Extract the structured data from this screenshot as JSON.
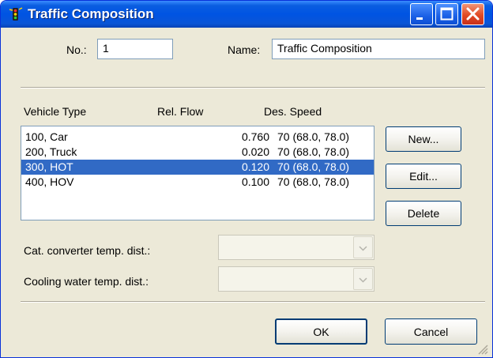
{
  "window": {
    "title": "Traffic Composition"
  },
  "form": {
    "no_label": "No.:",
    "no_value": "1",
    "name_label": "Name:",
    "name_value": "Traffic Composition"
  },
  "list": {
    "headers": [
      "Vehicle Type",
      "Rel. Flow",
      "Des. Speed"
    ],
    "rows": [
      {
        "type": "100, Car",
        "flow": "0.760",
        "speed": "70 (68.0, 78.0)",
        "selected": false
      },
      {
        "type": "200, Truck",
        "flow": "0.020",
        "speed": "70 (68.0, 78.0)",
        "selected": false
      },
      {
        "type": "300, HOT",
        "flow": "0.120",
        "speed": "70 (68.0, 78.0)",
        "selected": true
      },
      {
        "type": "400, HOV",
        "flow": "0.100",
        "speed": "70 (68.0, 78.0)",
        "selected": false
      }
    ]
  },
  "buttons": {
    "new": "New...",
    "edit": "Edit...",
    "delete": "Delete",
    "ok": "OK",
    "cancel": "Cancel"
  },
  "dists": {
    "cat_label": "Cat. converter temp. dist.:",
    "cat_value": "",
    "cool_label": "Cooling water temp. dist.:",
    "cool_value": ""
  },
  "colors": {
    "titlebar": "#0054e3",
    "selection": "#316ac5",
    "face": "#ece9d8"
  },
  "icons": {
    "title": "traffic-light-icon",
    "minimize": "minimize-icon",
    "maximize": "maximize-icon",
    "close": "close-icon",
    "combo_arrow": "chevron-down-icon",
    "grip": "resize-grip-icon"
  }
}
